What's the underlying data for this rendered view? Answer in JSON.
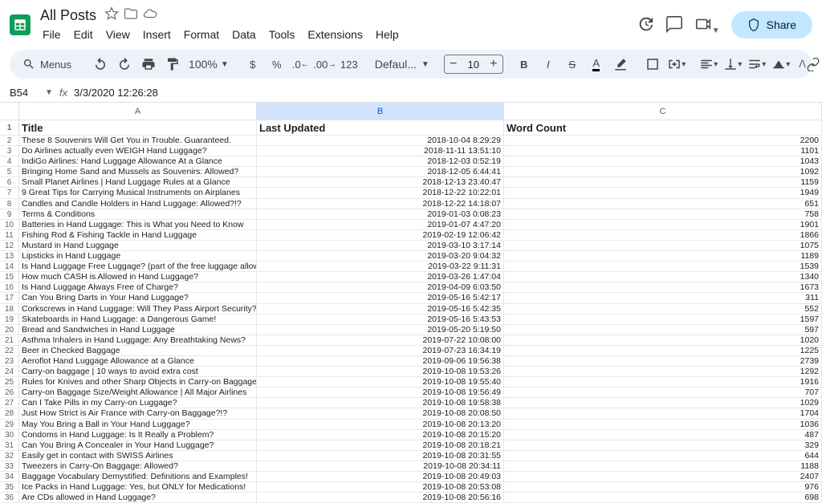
{
  "header": {
    "doc_title": "All Posts",
    "menus": [
      "File",
      "Edit",
      "View",
      "Insert",
      "Format",
      "Data",
      "Tools",
      "Extensions",
      "Help"
    ],
    "share_label": "Share"
  },
  "toolbar": {
    "menus_label": "Menus",
    "zoom": "100%",
    "font": "Defaul...",
    "font_size": "10"
  },
  "formula_bar": {
    "cell_ref": "B54",
    "value": "3/3/2020 12:26:28"
  },
  "columns": [
    {
      "letter": "A",
      "header": "Title"
    },
    {
      "letter": "B",
      "header": "Last Updated"
    },
    {
      "letter": "C",
      "header": "Word Count"
    }
  ],
  "rows": [
    {
      "n": 2,
      "title": "These 8 Souvenirs Will Get You in Trouble. Guaranteed.",
      "updated": "2018-10-04 8:29:29",
      "count": 2200
    },
    {
      "n": 3,
      "title": "Do Airlines actually even WEIGH Hand Luggage?",
      "updated": "2018-11-11 13:51:10",
      "count": 1101
    },
    {
      "n": 4,
      "title": "IndiGo Airlines: Hand Luggage Allowance At a Glance",
      "updated": "2018-12-03 0:52:19",
      "count": 1043
    },
    {
      "n": 5,
      "title": "Bringing Home Sand and Mussels as Souvenirs: Allowed?",
      "updated": "2018-12-05 6:44:41",
      "count": 1092
    },
    {
      "n": 6,
      "title": "Small Planet Airlines | Hand Luggage Rules at a Glance",
      "updated": "2018-12-13 23:40:47",
      "count": 1159
    },
    {
      "n": 7,
      "title": "9 Great Tips for Carrying Musical Instruments on Airplanes",
      "updated": "2018-12-22 10:22:01",
      "count": 1949
    },
    {
      "n": 8,
      "title": "Candles and Candle Holders in Hand Luggage: Allowed?!?",
      "updated": "2018-12-22 14:18:07",
      "count": 651
    },
    {
      "n": 9,
      "title": "Terms & Conditions",
      "updated": "2019-01-03 0:08:23",
      "count": 758
    },
    {
      "n": 10,
      "title": "Batteries in Hand Luggage: This is What you Need to Know",
      "updated": "2019-01-07 4:47:20",
      "count": 1901
    },
    {
      "n": 11,
      "title": "Fishing Rod & Fishing Tackle in Hand Luggage",
      "updated": "2019-02-19 12:06:42",
      "count": 1866
    },
    {
      "n": 12,
      "title": "Mustard in Hand Luggage",
      "updated": "2019-03-10 3:17:14",
      "count": 1075
    },
    {
      "n": 13,
      "title": "Lipsticks in Hand Luggage",
      "updated": "2019-03-20 9:04:32",
      "count": 1189
    },
    {
      "n": 14,
      "title": "Is Hand Luggage Free Luggage? (part of the free luggage allowance?)",
      "updated": "2019-03-22 9:11:31",
      "count": 1539
    },
    {
      "n": 15,
      "title": "How much CASH is Allowed in Hand Luggage?",
      "updated": "2019-03-26 1:47:04",
      "count": 1340
    },
    {
      "n": 16,
      "title": "Is Hand Luggage Always Free of Charge?",
      "updated": "2019-04-09 6:03:50",
      "count": 1673
    },
    {
      "n": 17,
      "title": "Can You Bring Darts in Your Hand Luggage?",
      "updated": "2019-05-16 5:42:17",
      "count": 311
    },
    {
      "n": 18,
      "title": "Corkscrews in Hand Luggage: Will They Pass Airport Security?",
      "updated": "2019-05-16 5:42:35",
      "count": 552
    },
    {
      "n": 19,
      "title": "Skateboards in Hand Luggage: a Dangerous Game!",
      "updated": "2019-05-16 5:43:53",
      "count": 1597
    },
    {
      "n": 20,
      "title": "Bread and Sandwiches in Hand Luggage",
      "updated": "2019-05-20 5:19:50",
      "count": 597
    },
    {
      "n": 21,
      "title": "Asthma Inhalers in Hand Luggage: Any Breathtaking News?",
      "updated": "2019-07-22 10:08:00",
      "count": 1020
    },
    {
      "n": 22,
      "title": "Beer in Checked Baggage",
      "updated": "2019-07-23 16:34:19",
      "count": 1225
    },
    {
      "n": 23,
      "title": "Aeroflot Hand Luggage Allowance at a Glance",
      "updated": "2019-09-06 19:56:38",
      "count": 2739
    },
    {
      "n": 24,
      "title": "Carry-on baggage | 10 ways to avoid extra cost",
      "updated": "2019-10-08 19:53:26",
      "count": 1292
    },
    {
      "n": 25,
      "title": "Rules for Knives and other Sharp Objects in Carry-on Baggage",
      "updated": "2019-10-08 19:55:40",
      "count": 1916
    },
    {
      "n": 26,
      "title": "Carry-on Baggage Size/Weight Allowance | All Major Airlines",
      "updated": "2019-10-08 19:56:49",
      "count": 707
    },
    {
      "n": 27,
      "title": "Can I Take Pills in my Carry-on Luggage?",
      "updated": "2019-10-08 19:58:38",
      "count": 1029
    },
    {
      "n": 28,
      "title": "Just How Strict is Air France with Carry-on Baggage?!?",
      "updated": "2019-10-08 20:08:50",
      "count": 1704
    },
    {
      "n": 29,
      "title": "May You Bring a Ball in Your Hand Luggage?",
      "updated": "2019-10-08 20:13:20",
      "count": 1036
    },
    {
      "n": 30,
      "title": "Condoms in Hand Luggage: Is It Really a Problem?",
      "updated": "2019-10-08 20:15:20",
      "count": 487
    },
    {
      "n": 31,
      "title": "Can You Bring A Concealer in Your Hand Luggage?",
      "updated": "2019-10-08 20:18:21",
      "count": 329
    },
    {
      "n": 32,
      "title": "Easily get in contact with SWISS Airlines",
      "updated": "2019-10-08 20:31:55",
      "count": 644
    },
    {
      "n": 33,
      "title": "Tweezers in Carry-On Baggage: Allowed?",
      "updated": "2019-10-08 20:34:11",
      "count": 1188
    },
    {
      "n": 34,
      "title": "Baggage Vocabulary Demystified: Definitions and Examples!",
      "updated": "2019-10-08 20:49:03",
      "count": 2407
    },
    {
      "n": 35,
      "title": "Ice Packs in Hand Luggage: Yes, but ONLY for Medications!",
      "updated": "2019-10-08 20:53:08",
      "count": 976
    },
    {
      "n": 36,
      "title": "Are CDs allowed in Hand Luggage?",
      "updated": "2019-10-08 20:56:16",
      "count": 698
    }
  ]
}
